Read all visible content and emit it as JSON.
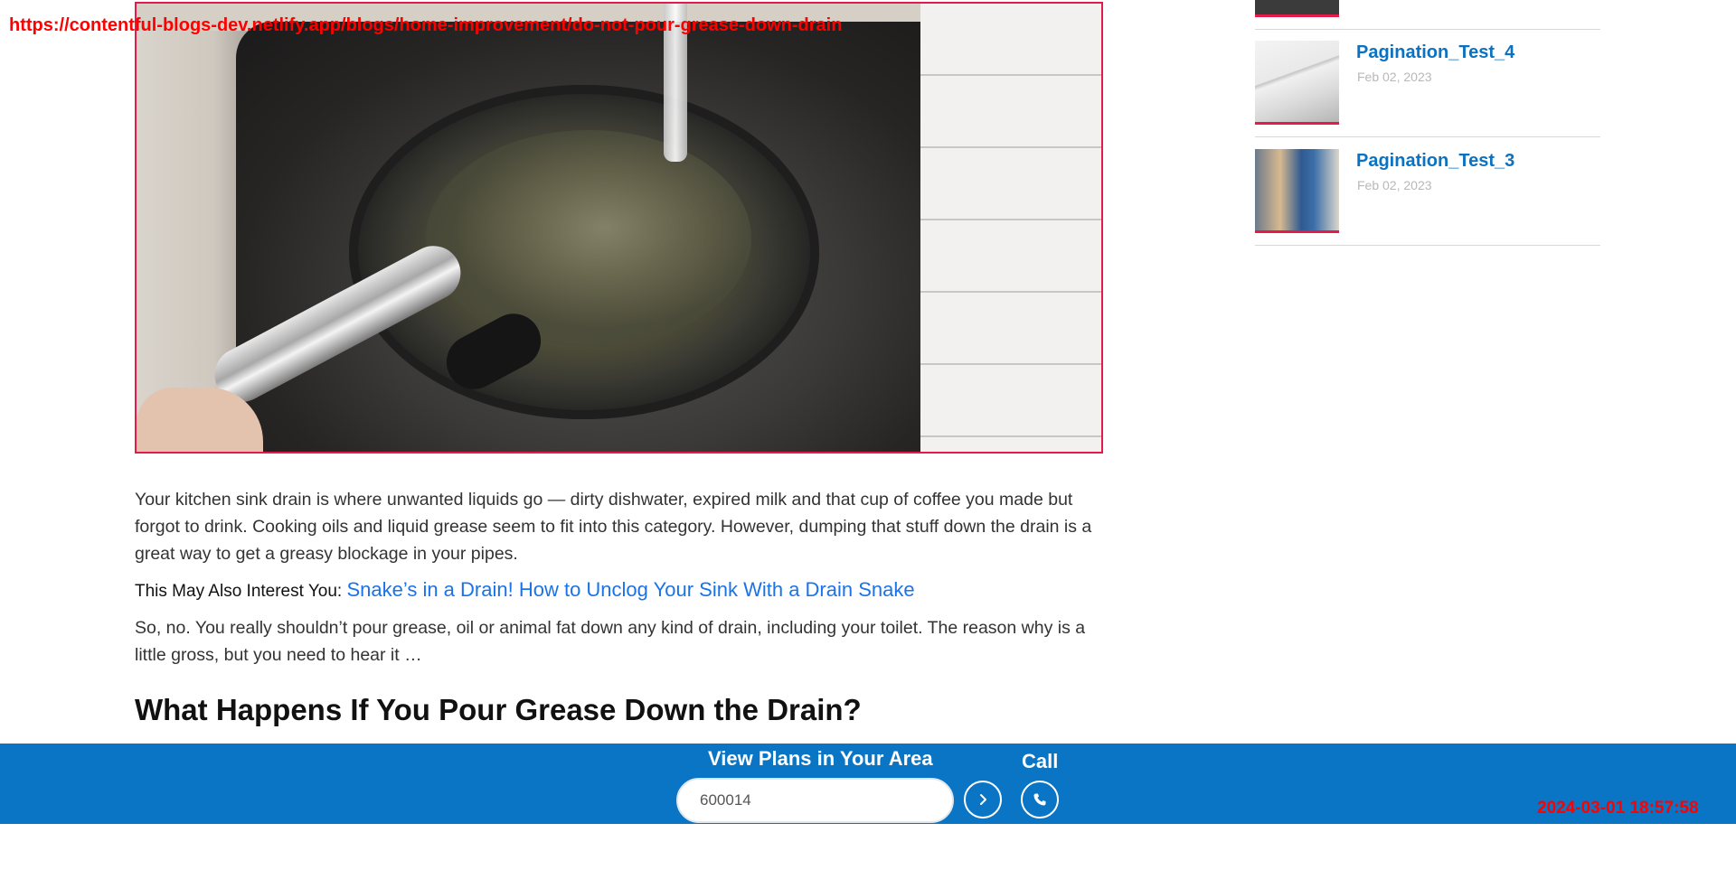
{
  "overlay": {
    "url": "https://contentful-blogs-dev.netlify.app/blogs/home-improvement/do-not-pour-grease-down-drain",
    "timestamp": "2024-03-01 18:57:58"
  },
  "article": {
    "hero_image": "frying-pan-in-sink",
    "paragraph_1": "Your kitchen sink drain is where unwanted liquids go — dirty dishwater, expired milk and that cup of coffee you made but forgot to drink. Cooking oils and liquid grease seem to fit into this category. However, dumping that stuff down the drain is a great way to get a greasy blockage in your pipes.",
    "interest_label": "This May Also Interest You:",
    "interest_link": "Snake’s in a Drain! How to Unclog Your Sink With a Drain Snake",
    "paragraph_2": "So, no. You really shouldn’t pour grease, oil or animal fat down any kind of drain, including your toilet. The reason why is a little gross, but you need to hear it …",
    "heading": "What Happens If You Pour Grease Down the Drain?"
  },
  "sidebar": {
    "items": [
      {
        "title": "Pagination_Test_4",
        "date": "Feb 02, 2023",
        "thumb": "house-roof"
      },
      {
        "title": "Pagination_Test_3",
        "date": "Feb 02, 2023",
        "thumb": "technician"
      }
    ]
  },
  "bottom_bar": {
    "heading": "View Plans in Your Area",
    "zip_value": "600014",
    "go_icon": "chevron-right-icon",
    "call_label": "Call",
    "call_icon": "phone-icon",
    "background": "#0a74c5"
  },
  "colors": {
    "accent": "#e31b4b",
    "link": "#1a73e8",
    "sidebar_title": "#0a72c2"
  }
}
